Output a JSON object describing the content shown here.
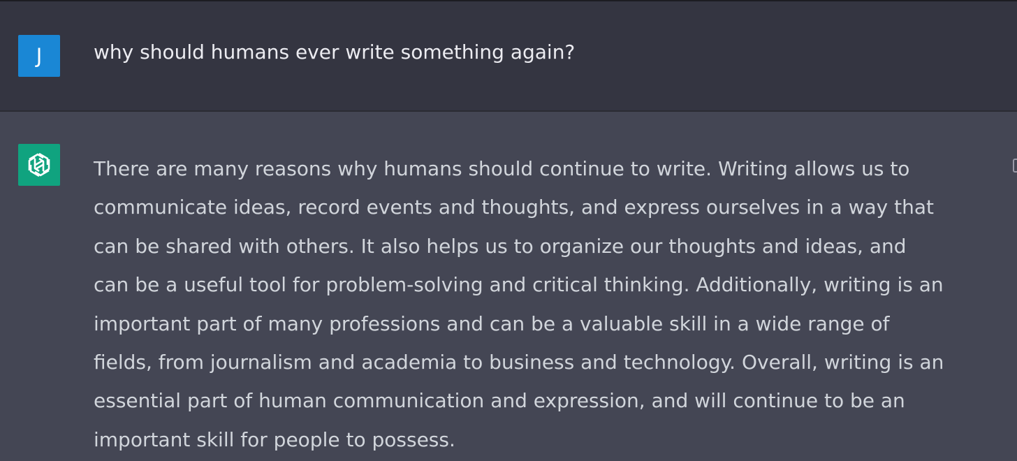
{
  "conversation": {
    "user": {
      "avatar_letter": "J",
      "avatar_color": "#1a87d5",
      "message": "why should humans ever write something again?"
    },
    "assistant": {
      "avatar_icon": "openai-logo-icon",
      "avatar_color": "#10a37f",
      "message_lines": [
        "There are many reasons why humans should continue to write. Writing allows us to",
        "communicate ideas, record events and thoughts, and express ourselves in a way that",
        "can be shared with others. It also helps us to organize our thoughts and ideas, and",
        "can be a useful tool for problem-solving and critical thinking. Additionally, writing is an",
        "important part of many professions and can be a valuable skill in a wide range of",
        "fields, from journalism and academia to business and technology. Overall, writing is an",
        "essential part of human communication and expression, and will continue to be an",
        "important skill for people to possess."
      ],
      "action_icon": "copy-icon"
    }
  },
  "colors": {
    "user_row_bg": "#343541",
    "assistant_row_bg": "#444654",
    "user_text": "#ececf1",
    "assistant_text": "#d1d5db"
  }
}
